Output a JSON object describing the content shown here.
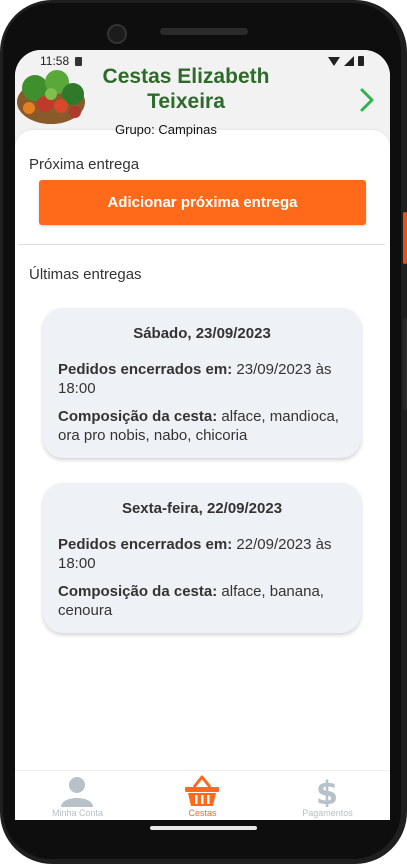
{
  "status_bar": {
    "time": "11:58"
  },
  "header": {
    "title_line1": "Cestas Elizabeth",
    "title_line2": "Teixeira",
    "group": "Grupo: Campinas"
  },
  "next_delivery": {
    "title": "Próxima entrega",
    "add_button": "Adicionar próxima entrega"
  },
  "last_deliveries": {
    "title": "Últimas entregas",
    "items": [
      {
        "date": "Sábado, 23/09/2023",
        "closed_label": "Pedidos encerrados em:",
        "closed_value": "23/09/2023 às 18:00",
        "composition_label": "Composição da cesta:",
        "composition_value": "alface, mandioca, ora pro nobis, nabo, chicoria"
      },
      {
        "date": "Sexta-feira, 22/09/2023",
        "closed_label": "Pedidos encerrados em:",
        "closed_value": "22/09/2023 às 18:00",
        "composition_label": "Composição da cesta:",
        "composition_value": "alface, banana, cenoura"
      }
    ]
  },
  "tabs": [
    {
      "label": "Minha Conta",
      "icon": "user-icon",
      "active": false
    },
    {
      "label": "Cestas",
      "icon": "basket-icon",
      "active": true
    },
    {
      "label": "Pagamentos",
      "icon": "dollar-icon",
      "active": false
    }
  ],
  "colors": {
    "accent": "#ff6a1a",
    "title_green": "#2e6b2a",
    "chevron_green": "#2fb34a",
    "tab_inactive": "#b8c0c8",
    "card_bg": "#eef2f7"
  }
}
